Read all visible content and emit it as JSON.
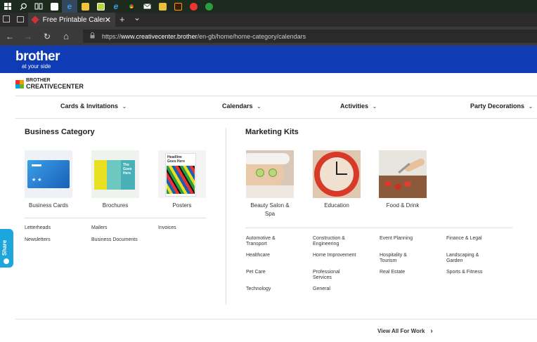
{
  "browser": {
    "tab_title": "Free Printable Calendars",
    "tab_close": "✕",
    "new_tab": "+",
    "tab_list": "⌄",
    "url_scheme": "https://",
    "url_host": "www.creativecenter.brother",
    "url_path": "/en-gb/home/home-category/calendars",
    "back": "←",
    "forward": "→",
    "refresh": "↻",
    "home": "⌂",
    "lock": "🔒"
  },
  "taskbar": {
    "icons": [
      "windows-start-icon",
      "search-icon",
      "task-view-icon",
      "store-icon",
      "edge-icon",
      "file-explorer-icon",
      "sticky-app-icon",
      "ie-icon",
      "chrome-icon",
      "mail-icon",
      "media-icon",
      "illustrator-icon",
      "photos-icon",
      "app-icon"
    ]
  },
  "brand": {
    "logo_word": "brother",
    "logo_tagline": "at your side",
    "bar_color": "#0f3bb4"
  },
  "cc_logo": {
    "top": "BROTHER",
    "bottom": "CREATIVECENTER"
  },
  "menu": {
    "items": [
      "Cards & Invitations",
      "Calendars",
      "Activities",
      "Party Decorations"
    ],
    "chevron": "⌄"
  },
  "business": {
    "title": "Business Category",
    "cards": [
      "Business Cards",
      "Brochures",
      "Posters"
    ],
    "links": [
      "Letterheads",
      "Mailers",
      "Invoices",
      "Newsletters",
      "Business Documents"
    ]
  },
  "marketing": {
    "title": "Marketing Kits",
    "cards": [
      "Beauty Salon &\nSpa",
      "Education",
      "Food & Drink"
    ],
    "links": [
      "Automotive &\nTransport",
      "Construction &\nEngineering",
      "Event Planning",
      "Finance & Legal",
      "Healthcare",
      "Home Improvement",
      "Hospitality &\nTourism",
      "Landscaping &\nGarden",
      "Pet Care",
      "Professional\nServices",
      "Real Estate",
      "Sports & Fitness",
      "Technology",
      "General"
    ]
  },
  "footer": {
    "view_all": "View All For Work",
    "arrow": "›"
  },
  "share": {
    "label": "Share",
    "color": "#1da5dd"
  }
}
